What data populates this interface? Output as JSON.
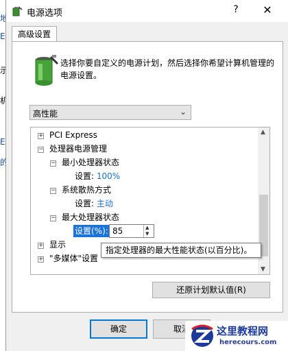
{
  "window": {
    "title": "电源选项",
    "help": "?",
    "close": "✕"
  },
  "tab": {
    "label": "高级设置"
  },
  "description": "选择你要自定义的电源计划，然后选择你希望计算机管理的电源设置。",
  "plan_select": {
    "value": "高性能"
  },
  "tree": {
    "items": [
      {
        "label": "PCI Express",
        "toggle": "+"
      },
      {
        "label": "处理器电源管理",
        "toggle": "−"
      },
      {
        "label": "最小处理器状态",
        "toggle": "−"
      },
      {
        "setting_label": "设置:",
        "setting_value": "100%"
      },
      {
        "label": "系统散热方式",
        "toggle": "−"
      },
      {
        "setting_label": "设置:",
        "setting_value": "主动"
      },
      {
        "label": "最大处理器状态",
        "toggle": "−"
      },
      {
        "label": "显示",
        "toggle": "+"
      },
      {
        "label": "\"多媒体\"设置",
        "toggle": "+"
      }
    ],
    "editing": {
      "label": "设置(%):",
      "value": "85"
    }
  },
  "tooltip": "指定处理器的最大性能状态(以百分比)。",
  "buttons": {
    "restore": "还原计划默认值(R)",
    "ok": "确定",
    "cancel": "取消"
  },
  "watermark": {
    "title": "这里教程网",
    "url": "herecours.com"
  },
  "background_fragments": [
    "地",
    "E",
    "示",
    "机",
    "E",
    "的"
  ]
}
